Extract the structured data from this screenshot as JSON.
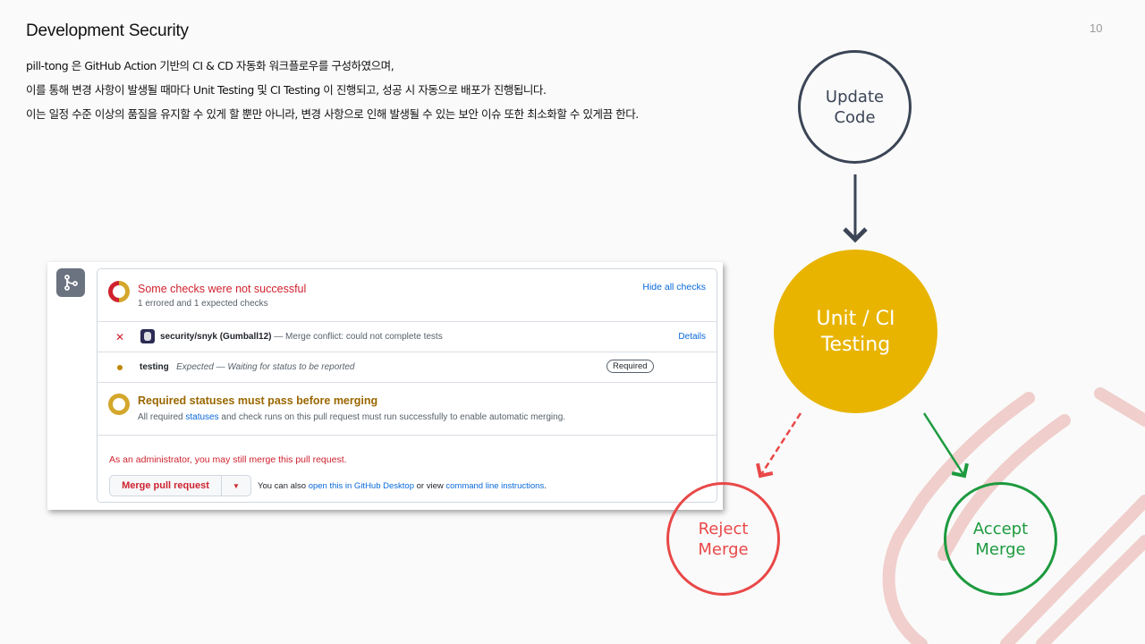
{
  "slide": {
    "title": "Development Security",
    "page_number": "10",
    "description": [
      "pill-tong 은 GitHub Action 기반의 CI & CD 자동화 워크플로우를 구성하였으며,",
      "이를 통해 변경 사항이 발생될 때마다 Unit Testing 및 CI Testing 이 진행되고, 성공 시 자동으로 배포가 진행됩니다.",
      "이는 일정 수준 이상의 품질을 유지할 수 있게 할 뿐만 아니라, 변경 사항으로 인해 발생될 수 있는 보안 이슈 또한 최소화할 수 있게끔 한다."
    ]
  },
  "github_merge_box": {
    "icon": "git-merge-icon",
    "checks_header": {
      "title": "Some checks were not successful",
      "subtitle": "1 errored and 1 expected checks",
      "toggle_label": "Hide all checks"
    },
    "checks": [
      {
        "status_icon": "x-icon",
        "name": "security/snyk (Gumball12)",
        "description": "— Merge conflict: could not complete tests",
        "action_label": "Details"
      },
      {
        "status_icon": "pending-dot-icon",
        "name": "testing",
        "description": "Expected — Waiting for status to be reported",
        "badge": "Required"
      }
    ],
    "required_section": {
      "title": "Required statuses must pass before merging",
      "text_before_link": "All required ",
      "link": "statuses",
      "text_after_link": " and check runs on this pull request must run successfully to enable automatic merging."
    },
    "admin_notice": "As an administrator, you may still merge this pull request.",
    "merge_button": {
      "label": "Merge pull request",
      "caret": "▼"
    },
    "alternatives": {
      "prefix": "You can also ",
      "desktop_link": "open this in GitHub Desktop",
      "middle": " or view ",
      "cli_link": "command line instructions",
      "suffix": "."
    }
  },
  "flow": {
    "update": [
      "Update",
      "Code"
    ],
    "testing": [
      "Unit / CI",
      "Testing"
    ],
    "reject": [
      "Reject",
      "Merge"
    ],
    "accept": [
      "Accept",
      "Merge"
    ]
  },
  "colors": {
    "update": "#3b4556",
    "testing": "#e8b400",
    "reject": "#e94848",
    "accept": "#1d9a3f",
    "decoration": "#eec7c3"
  }
}
